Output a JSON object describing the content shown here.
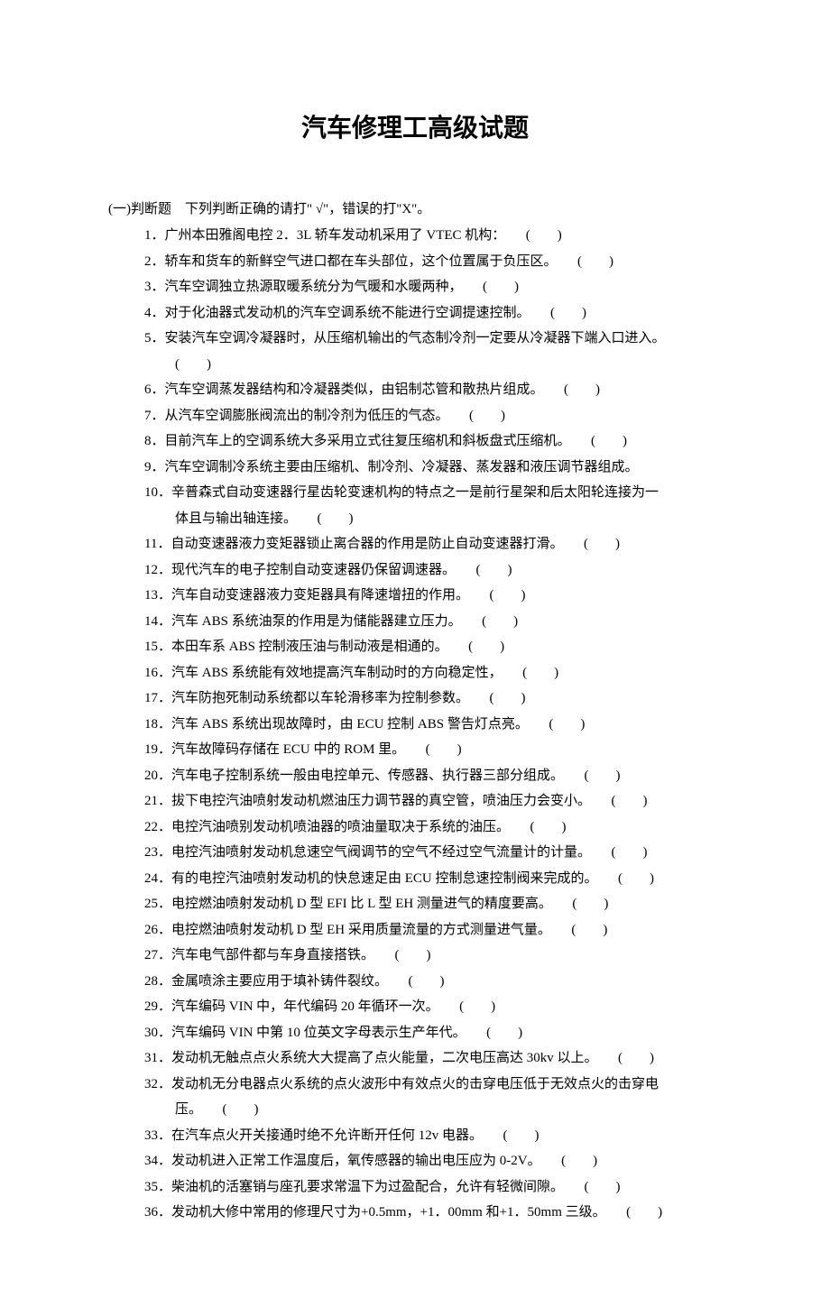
{
  "title": "汽车修理工高级试题",
  "section": {
    "intro": "(一)判断题　下列判断正确的请打\" √\"，错误的打\"X\"。",
    "items": [
      {
        "num": "1．",
        "text": "广州本田雅阁电控 2．3L 轿车发动机采用了 VTEC 机构：　　(　　)"
      },
      {
        "num": "2．",
        "text": "轿车和货车的新鲜空气进口都在车头部位，这个位置属于负压区。　　(　　)"
      },
      {
        "num": "3．",
        "text": "汽车空调独立热源取暖系统分为气暖和水暖两种，　　(　　)"
      },
      {
        "num": "4．",
        "text": "对于化油器式发动机的汽车空调系统不能进行空调提速控制。　　(　　)"
      },
      {
        "num": "5．",
        "text": "安装汽车空调冷凝器时，从压缩机输出的气态制冷剂一定要从冷凝器下端入口进入。",
        "cont": "(　　)"
      },
      {
        "num": "6．",
        "text": "汽车空调蒸发器结构和冷凝器类似，由铝制芯管和散热片组成。　　(　　)"
      },
      {
        "num": "7．",
        "text": "从汽车空调膨胀阀流出的制冷剂为低压的气态。　　(　　)"
      },
      {
        "num": "8．",
        "text": "目前汽车上的空调系统大多采用立式往复压缩机和斜板盘式压缩机。　　(　　)"
      },
      {
        "num": "9．",
        "text": "汽车空调制冷系统主要由压缩机、制冷剂、冷凝器、蒸发器和液压调节器组成。"
      },
      {
        "num": "10．",
        "text": "辛普森式自动变速器行星齿轮变速机构的特点之一是前行星架和后太阳轮连接为一",
        "cont": "体且与输出轴连接。　　(　　)"
      },
      {
        "num": "11．",
        "text": "自动变速器液力变矩器锁止离合器的作用是防止自动变速器打滑。　　(　　)"
      },
      {
        "num": "12．",
        "text": "现代汽车的电子控制自动变速器仍保留调速器。　　(　　)"
      },
      {
        "num": "13．",
        "text": "汽车自动变速器液力变矩器具有降速增扭的作用。　　(　　)"
      },
      {
        "num": "14．",
        "text": "汽车 ABS 系统油泵的作用是为储能器建立压力。　　(　　)"
      },
      {
        "num": "15．",
        "text": "本田车系 ABS 控制液压油与制动液是相通的。　　(　　)"
      },
      {
        "num": "16．",
        "text": "汽车 ABS 系统能有效地提高汽车制动时的方向稳定性，　　(　　)"
      },
      {
        "num": "17．",
        "text": "汽车防抱死制动系统都以车轮滑移率为控制参数。　　(　　)"
      },
      {
        "num": "18．",
        "text": "汽车 ABS 系统出现故障时，由 ECU 控制 ABS 警告灯点亮。　　(　　)"
      },
      {
        "num": "19．",
        "text": "汽车故障码存储在 ECU 中的 ROM 里。　　(　　)"
      },
      {
        "num": "20．",
        "text": "汽车电子控制系统一般由电控单元、传感器、执行器三部分组成。　　(　　)"
      },
      {
        "num": "21．",
        "text": "拔下电控汽油喷射发动机燃油压力调节器的真空管，喷油压力会变小。　　(　　)"
      },
      {
        "num": "22．",
        "text": "电控汽油喷别发动机喷油器的喷油量取决于系统的油压。　　(　　)"
      },
      {
        "num": "23．",
        "text": "电控汽油喷射发动机怠速空气阀调节的空气不经过空气流量计的计量。　　(　　)"
      },
      {
        "num": "24．",
        "text": "有的电控汽油喷射发动机的快怠速足由 ECU 控制怠速控制阀来完成的。　　(　　)"
      },
      {
        "num": "25．",
        "text": "电控燃油喷射发动机 D 型 EFI 比 L 型 EH 测量进气的精度要高。　　(　　)"
      },
      {
        "num": "26．",
        "text": "电控燃油喷射发动机 D 型 EH 采用质量流量的方式测量进气量。　　(　　)"
      },
      {
        "num": "27．",
        "text": "汽车电气部件都与车身直接搭铁。　　(　　)"
      },
      {
        "num": "28．",
        "text": "金属喷涂主要应用于填补铸件裂纹。　　(　　)"
      },
      {
        "num": "29．",
        "text": "汽车编码 VIN 中，年代编码 20 年循环一次。　　(　　)"
      },
      {
        "num": "30．",
        "text": "汽车编码 VIN 中第 10 位英文字母表示生产年代。　　(　　)"
      },
      {
        "num": "31．",
        "text": "发动机无触点点火系统大大提高了点火能量，二次电压高达 30kv 以上。　　(　　)"
      },
      {
        "num": "32．",
        "text": "发动机无分电器点火系统的点火波形中有效点火的击穿电压低于无效点火的击穿电",
        "cont": "压。　　(　　)"
      },
      {
        "num": "33．",
        "text": "在汽车点火开关接通时绝不允许断开任何 12v 电器。　　(　　)"
      },
      {
        "num": "34．",
        "text": "发动机进入正常工作温度后，氧传感器的输出电压应为 0-2V。　　(　　)"
      },
      {
        "num": "35．",
        "text": "柴油机的活塞销与座孔要求常温下为过盈配合，允许有轻微间隙。　　(　　)"
      },
      {
        "num": "36．",
        "text": "发动机大修中常用的修理尺寸为+0.5mm，+1．00mm 和+1．50mm 三级。　　(　　)"
      }
    ]
  }
}
